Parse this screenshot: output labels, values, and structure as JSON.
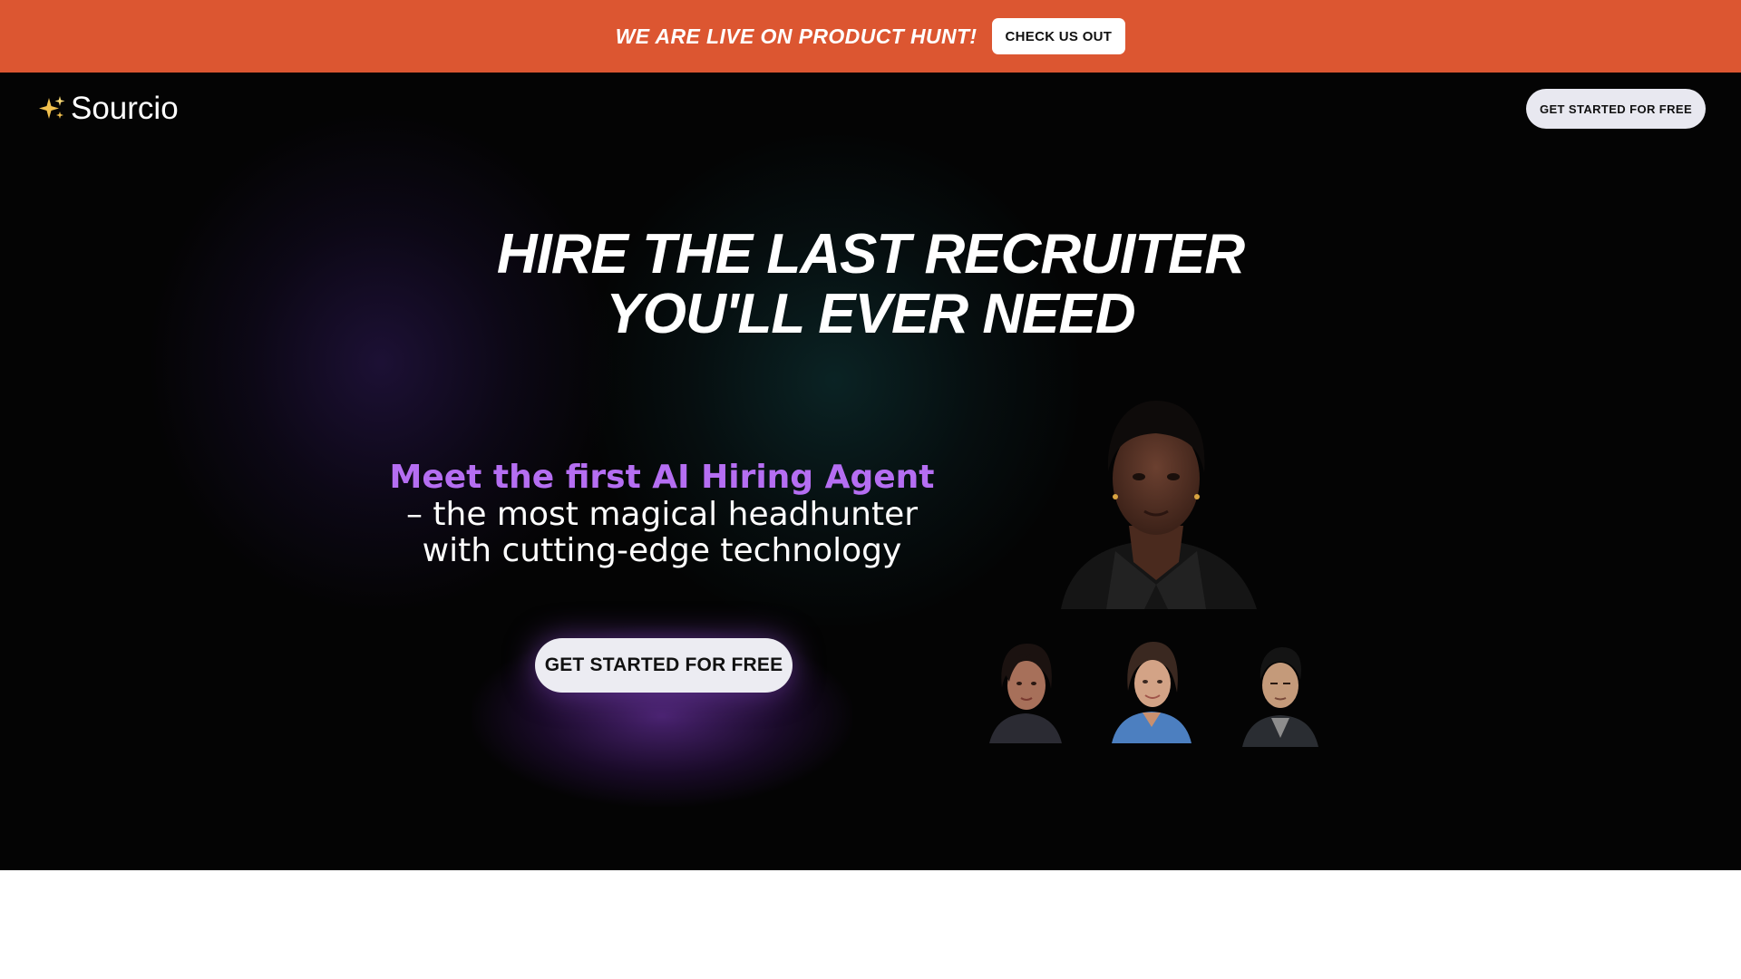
{
  "announcement": {
    "text": "WE ARE LIVE ON PRODUCT HUNT!",
    "button_label": "CHECK US OUT",
    "background_color": "#dc5631"
  },
  "nav": {
    "logo_icon": "sparkles-icon",
    "logo_text": "Sourcio",
    "cta_label": "GET STARTED FOR FREE"
  },
  "hero": {
    "headline_line1": "HIRE THE LAST RECRUITER",
    "headline_line2": "YOU'LL EVER NEED",
    "sub_accent": "Meet the first AI Hiring Agent",
    "sub_line1": "– the most magical headhunter",
    "sub_line2": "with cutting-edge technology",
    "accent_color": "#b56ef2",
    "cta_label": "GET STARTED FOR FREE"
  },
  "avatars": {
    "main": "avatar-woman-black-blazer",
    "small": [
      "avatar-woman-dark-hair",
      "avatar-woman-blue-shirt",
      "avatar-man-dark-jacket"
    ]
  }
}
